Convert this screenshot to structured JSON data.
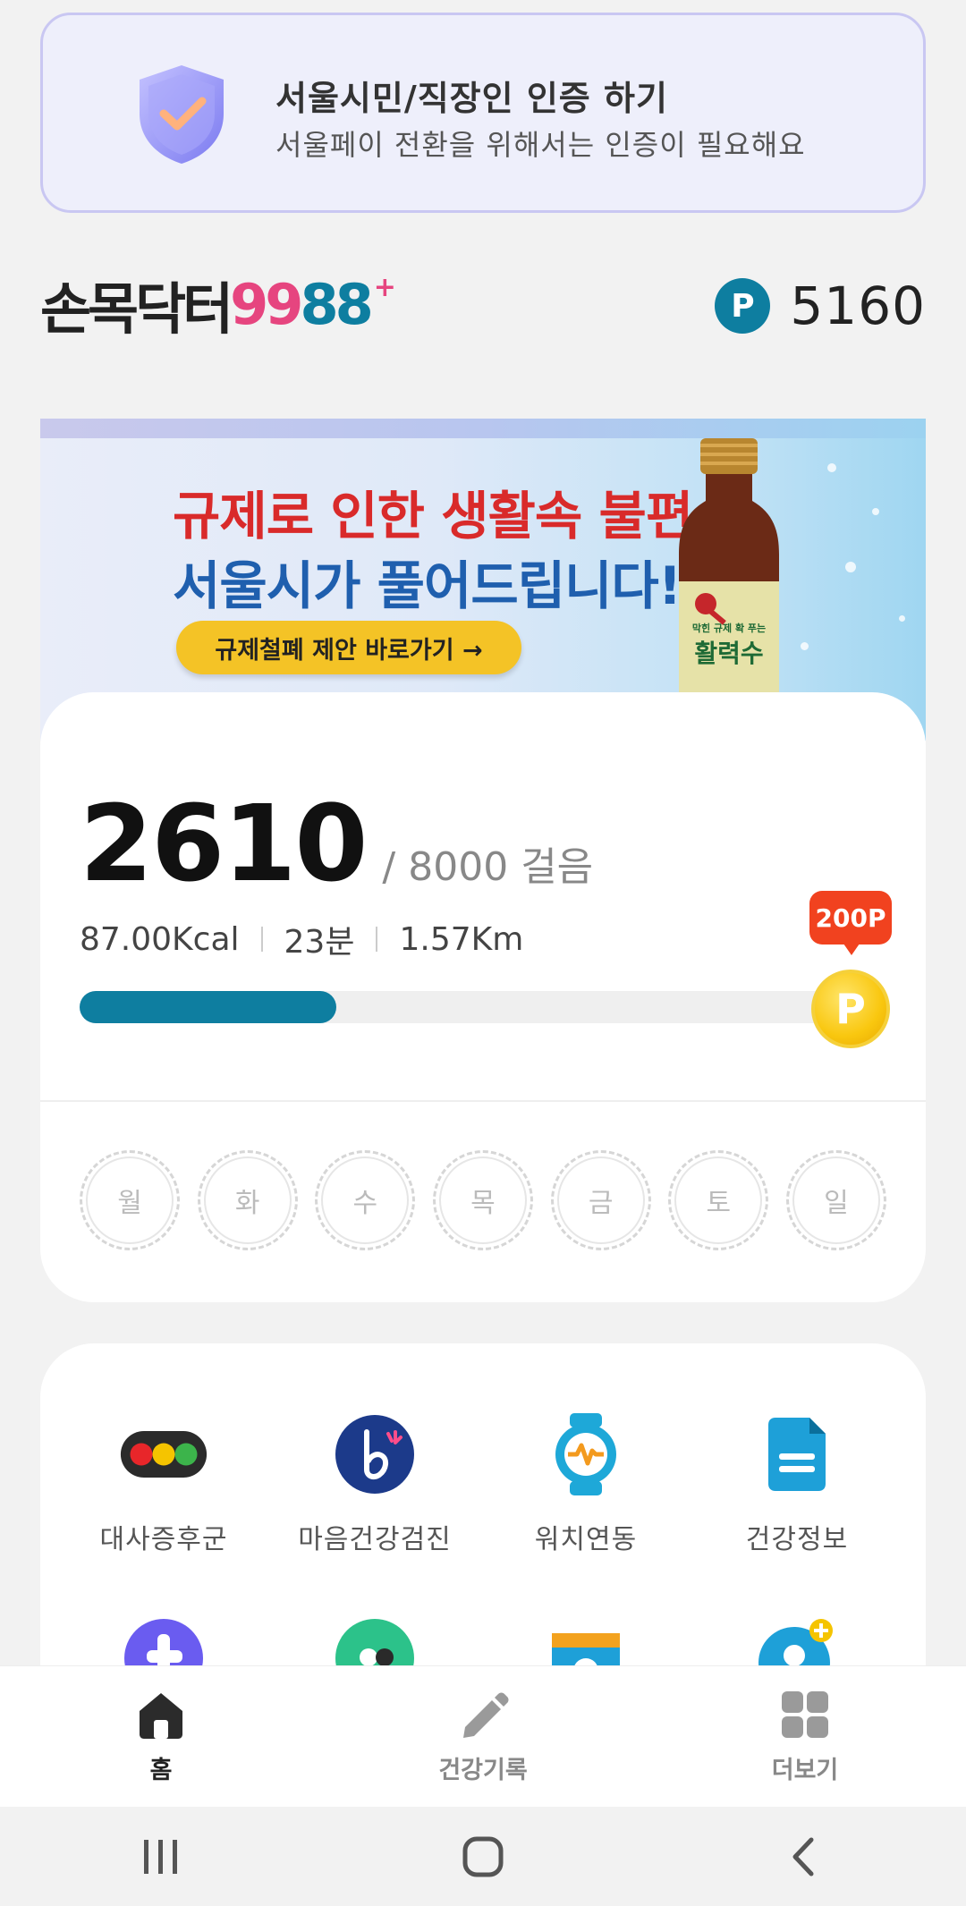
{
  "verify_banner": {
    "title": "서울시민/직장인 인증 하기",
    "subtitle": "서울페이 전환을 위해서는 인증이 필요해요"
  },
  "header": {
    "brand_text": "손목닥터",
    "brand_num_a": "99",
    "brand_num_b": "88",
    "brand_plus": "+",
    "points_icon": "P",
    "points": "5160"
  },
  "promo": {
    "line1": "규제로 인한 생활속 불편,",
    "line2": "서울시가 풀어드립니다!",
    "cta": "규제철폐 제안 바로가기 →",
    "bottle_label_top": "막힌 규제 확 푸는",
    "bottle_label_main": "활력수"
  },
  "steps": {
    "count": "2610",
    "goal": "/ 8000 걸음",
    "kcal": "87.00Kcal",
    "minutes": "23분",
    "distance": "1.57Km",
    "progress_fraction": 0.3263,
    "reward": "200P",
    "coin_letter": "P"
  },
  "week_days": [
    "월",
    "화",
    "수",
    "목",
    "금",
    "토",
    "일"
  ],
  "menu": {
    "row1": [
      {
        "label": "대사증후군",
        "icon": "traffic-light-icon"
      },
      {
        "label": "마음건강검진",
        "icon": "mind-b-icon"
      },
      {
        "label": "워치연동",
        "icon": "smartwatch-icon"
      },
      {
        "label": "건강정보",
        "icon": "document-icon"
      }
    ]
  },
  "bottom_nav": [
    {
      "label": "홈",
      "icon": "home-icon",
      "active": true
    },
    {
      "label": "건강기록",
      "icon": "pencil-icon",
      "active": false
    },
    {
      "label": "더보기",
      "icon": "grid-icon",
      "active": false
    }
  ],
  "colors": {
    "primary": "#0e7ea0",
    "reward": "#f1421f",
    "coin": "#f9c70f",
    "brand_pink": "#e6457f"
  }
}
